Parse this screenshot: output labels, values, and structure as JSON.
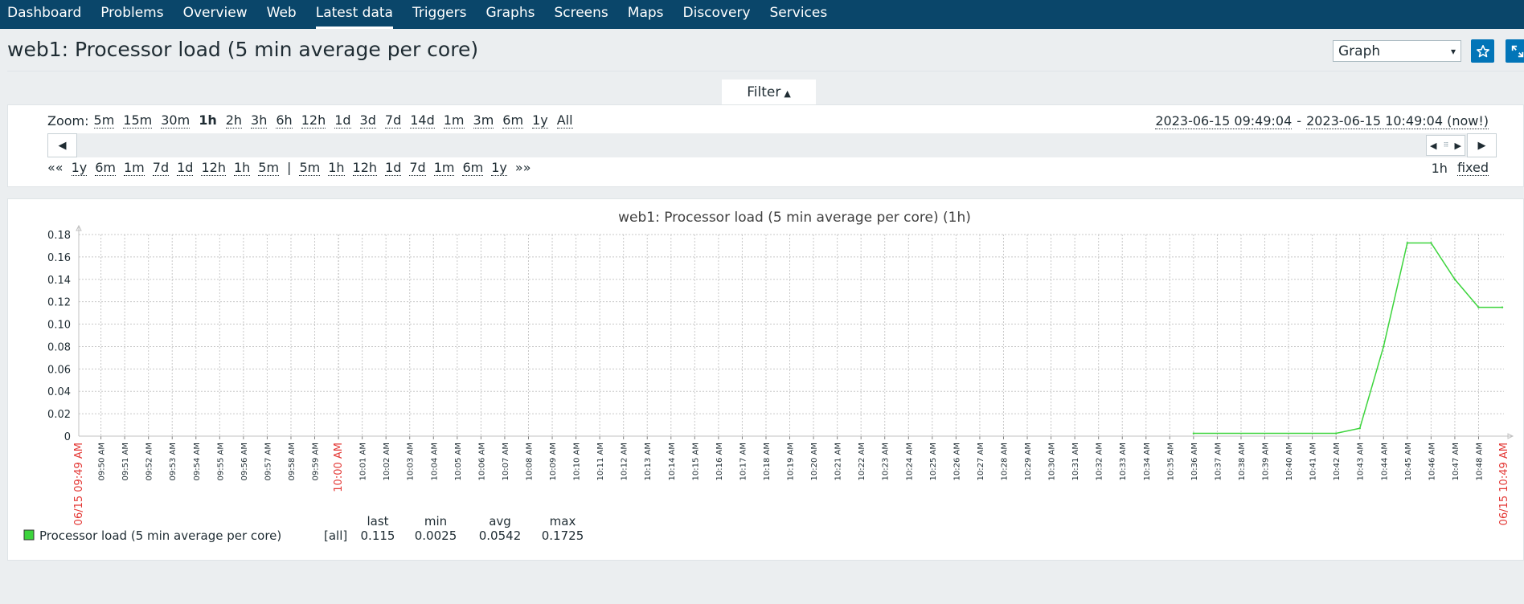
{
  "nav": {
    "items": [
      {
        "label": "Dashboard"
      },
      {
        "label": "Problems"
      },
      {
        "label": "Overview"
      },
      {
        "label": "Web"
      },
      {
        "label": "Latest data",
        "active": true
      },
      {
        "label": "Triggers"
      },
      {
        "label": "Graphs"
      },
      {
        "label": "Screens"
      },
      {
        "label": "Maps"
      },
      {
        "label": "Discovery"
      },
      {
        "label": "Services"
      }
    ]
  },
  "header": {
    "title": "web1: Processor load (5 min average per core)",
    "view_select": "Graph",
    "favorite_icon": "star-icon",
    "fullscreen_icon": "fullscreen-icon"
  },
  "filter": {
    "tab_label": "Filter",
    "zoom_label": "Zoom:",
    "zoom_options": [
      "5m",
      "15m",
      "30m",
      "1h",
      "2h",
      "3h",
      "6h",
      "12h",
      "1d",
      "3d",
      "7d",
      "14d",
      "1m",
      "3m",
      "6m",
      "1y",
      "All"
    ],
    "zoom_selected": "1h",
    "range_from": "2023-06-15 09:49:04",
    "range_sep": "-",
    "range_to": "2023-06-15 10:49:04 (now!)",
    "back_all": "««",
    "back_options": [
      "1y",
      "6m",
      "1m",
      "7d",
      "1d",
      "12h",
      "1h",
      "5m"
    ],
    "divider": "|",
    "forward_options": [
      "5m",
      "1h",
      "12h",
      "1d",
      "7d",
      "1m",
      "6m",
      "1y"
    ],
    "forward_all": "»»",
    "period": "1h",
    "fixed_label": "fixed"
  },
  "chart_data": {
    "type": "line",
    "title": "web1: Processor load (5 min average per core) (1h)",
    "ylim": [
      0,
      0.18
    ],
    "yticks": [
      "0",
      "0.02",
      "0.04",
      "0.06",
      "0.08",
      "0.10",
      "0.12",
      "0.14",
      "0.16",
      "0.18"
    ],
    "x_start_label": "06/15 09:49 AM",
    "x_end_label": "06/15 10:49 AM",
    "x_hour_label": "10:00 AM",
    "x_minute_labels": [
      "09:50 AM",
      "09:51 AM",
      "09:52 AM",
      "09:53 AM",
      "09:54 AM",
      "09:55 AM",
      "09:56 AM",
      "09:57 AM",
      "09:58 AM",
      "09:59 AM",
      "10:00 AM",
      "10:01 AM",
      "10:02 AM",
      "10:03 AM",
      "10:04 AM",
      "10:05 AM",
      "10:06 AM",
      "10:07 AM",
      "10:08 AM",
      "10:09 AM",
      "10:10 AM",
      "10:11 AM",
      "10:12 AM",
      "10:13 AM",
      "10:14 AM",
      "10:15 AM",
      "10:16 AM",
      "10:17 AM",
      "10:18 AM",
      "10:19 AM",
      "10:20 AM",
      "10:21 AM",
      "10:22 AM",
      "10:23 AM",
      "10:24 AM",
      "10:25 AM",
      "10:26 AM",
      "10:27 AM",
      "10:28 AM",
      "10:29 AM",
      "10:30 AM",
      "10:31 AM",
      "10:32 AM",
      "10:33 AM",
      "10:34 AM",
      "10:35 AM",
      "10:36 AM",
      "10:37 AM",
      "10:38 AM",
      "10:39 AM",
      "10:40 AM",
      "10:41 AM",
      "10:42 AM",
      "10:43 AM",
      "10:44 AM",
      "10:45 AM",
      "10:46 AM",
      "10:47 AM",
      "10:48 AM"
    ],
    "series": [
      {
        "name": "Processor load (5 min average per core)",
        "color": "#3cd43c",
        "points": [
          {
            "x": "10:36",
            "y": 0.0025
          },
          {
            "x": "10:42",
            "y": 0.0025
          },
          {
            "x": "10:43",
            "y": 0.007
          },
          {
            "x": "10:44",
            "y": 0.08
          },
          {
            "x": "10:45",
            "y": 0.1725
          },
          {
            "x": "10:46",
            "y": 0.1725
          },
          {
            "x": "10:47",
            "y": 0.14
          },
          {
            "x": "10:48",
            "y": 0.115
          },
          {
            "x": "10:49",
            "y": 0.115
          }
        ]
      }
    ],
    "grid": true,
    "legend": {
      "headers": [
        "last",
        "min",
        "avg",
        "max"
      ],
      "rows": [
        {
          "name": "Processor load (5 min average per core)",
          "func": "[all]",
          "last": "0.115",
          "min": "0.0025",
          "avg": "0.0542",
          "max": "0.1725",
          "color": "#3cd43c"
        }
      ]
    }
  }
}
